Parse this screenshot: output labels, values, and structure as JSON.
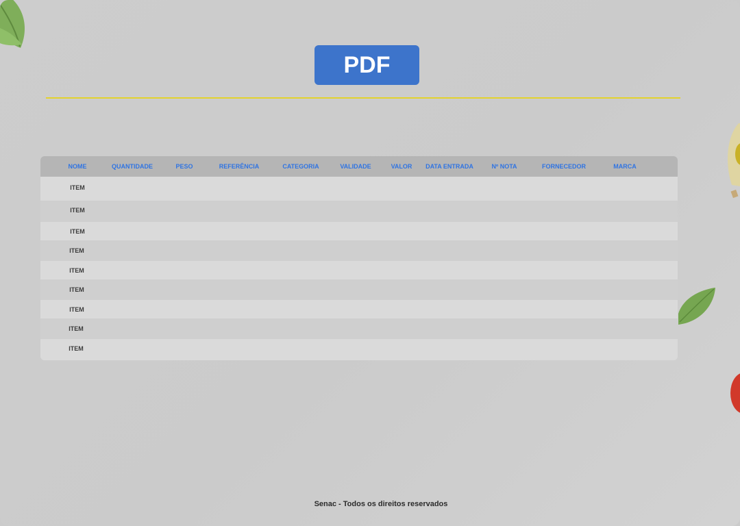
{
  "header": {
    "button_label": "PDF"
  },
  "table": {
    "columns": [
      "NOME",
      "QUANTIDADE",
      "PESO",
      "REFERÊNCIA",
      "CATEGORIA",
      "VALIDADE",
      "VALOR",
      "DATA ENTRADA",
      "Nº NOTA",
      "FORNECEDOR",
      "MARCA"
    ],
    "rows": [
      {
        "nome": "ITEM"
      },
      {
        "nome": "ITEM"
      },
      {
        "nome": "ITEM"
      },
      {
        "nome": "ITEM"
      },
      {
        "nome": "ITEM"
      },
      {
        "nome": "ITEM"
      },
      {
        "nome": "ITEM"
      },
      {
        "nome": "ITEM"
      },
      {
        "nome": "ITEM"
      }
    ]
  },
  "footer": {
    "text": "Senac - Todos os direitos reservados"
  },
  "colors": {
    "accent": "#3d74cb",
    "divider": "#e3d22c",
    "header_text": "#2f74e3"
  },
  "icons": [
    "basil-leaf-icon",
    "olive-oil-icon",
    "tomato-icon"
  ]
}
